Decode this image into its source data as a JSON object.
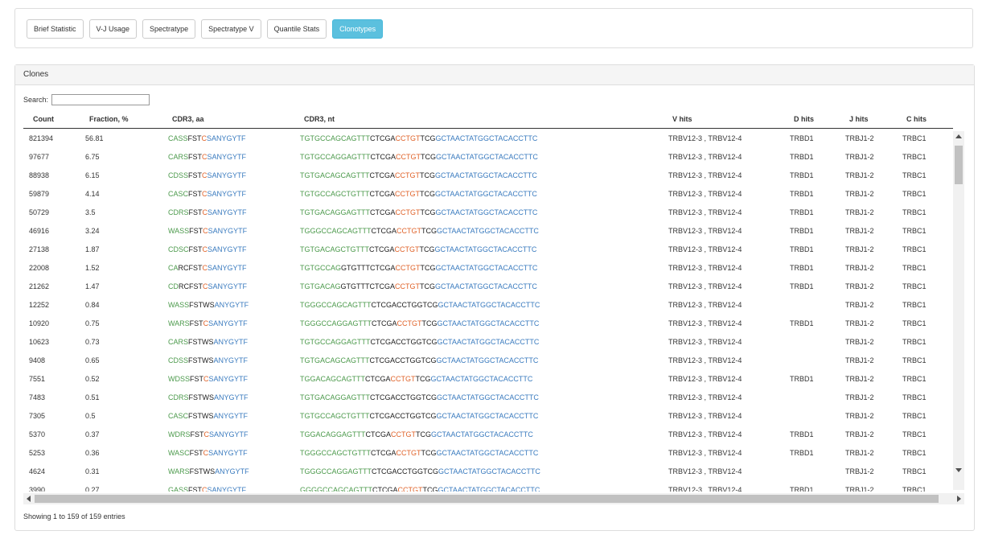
{
  "tabs": [
    {
      "label": "Brief Statistic",
      "active": false
    },
    {
      "label": "V-J Usage",
      "active": false
    },
    {
      "label": "Spectratype",
      "active": false
    },
    {
      "label": "Spectratype V",
      "active": false
    },
    {
      "label": "Quantile Stats",
      "active": false
    },
    {
      "label": "Clonotypes",
      "active": true
    }
  ],
  "panel": {
    "title": "Clones"
  },
  "search": {
    "label": "Search:",
    "value": ""
  },
  "columns": [
    "Count",
    "Fraction, %",
    "CDR3, aa",
    "CDR3, nt",
    "V hits",
    "D hits",
    "J hits",
    "C hits"
  ],
  "colors": {
    "green": "#4c9a4c",
    "black": "#222222",
    "orange": "#e0632a",
    "blue": "#3a7bbf",
    "active_tab": "#5bc0de"
  },
  "rows": [
    {
      "count": "821394",
      "fraction": "56.81",
      "aa": [
        [
          "CASS",
          "g"
        ],
        [
          "FST",
          "k"
        ],
        [
          "C",
          "o"
        ],
        [
          "SANYGYTF",
          "b"
        ]
      ],
      "nt": [
        [
          "TGTGCCAGCAGTTT",
          "g"
        ],
        [
          "CTCGA",
          "k"
        ],
        [
          "CCTGT",
          "o"
        ],
        [
          "TCG",
          "k"
        ],
        [
          "GCTAACTATGGCTACACCTTC",
          "b"
        ]
      ],
      "v": "TRBV12-3 , TRBV12-4",
      "d": "TRBD1",
      "j": "TRBJ1-2",
      "c": "TRBC1"
    },
    {
      "count": "97677",
      "fraction": "6.75",
      "aa": [
        [
          "CARS",
          "g"
        ],
        [
          "FST",
          "k"
        ],
        [
          "C",
          "o"
        ],
        [
          "SANYGYTF",
          "b"
        ]
      ],
      "nt": [
        [
          "TGTGCCAGGAGTTT",
          "g"
        ],
        [
          "CTCGA",
          "k"
        ],
        [
          "CCTGT",
          "o"
        ],
        [
          "TCG",
          "k"
        ],
        [
          "GCTAACTATGGCTACACCTTC",
          "b"
        ]
      ],
      "v": "TRBV12-3 , TRBV12-4",
      "d": "TRBD1",
      "j": "TRBJ1-2",
      "c": "TRBC1"
    },
    {
      "count": "88938",
      "fraction": "6.15",
      "aa": [
        [
          "CDSS",
          "g"
        ],
        [
          "FST",
          "k"
        ],
        [
          "C",
          "o"
        ],
        [
          "SANYGYTF",
          "b"
        ]
      ],
      "nt": [
        [
          "TGTGACAGCAGTTT",
          "g"
        ],
        [
          "CTCGA",
          "k"
        ],
        [
          "CCTGT",
          "o"
        ],
        [
          "TCG",
          "k"
        ],
        [
          "GCTAACTATGGCTACACCTTC",
          "b"
        ]
      ],
      "v": "TRBV12-3 , TRBV12-4",
      "d": "TRBD1",
      "j": "TRBJ1-2",
      "c": "TRBC1"
    },
    {
      "count": "59879",
      "fraction": "4.14",
      "aa": [
        [
          "CASC",
          "g"
        ],
        [
          "FST",
          "k"
        ],
        [
          "C",
          "o"
        ],
        [
          "SANYGYTF",
          "b"
        ]
      ],
      "nt": [
        [
          "TGTGCCAGCTGTTT",
          "g"
        ],
        [
          "CTCGA",
          "k"
        ],
        [
          "CCTGT",
          "o"
        ],
        [
          "TCG",
          "k"
        ],
        [
          "GCTAACTATGGCTACACCTTC",
          "b"
        ]
      ],
      "v": "TRBV12-3 , TRBV12-4",
      "d": "TRBD1",
      "j": "TRBJ1-2",
      "c": "TRBC1"
    },
    {
      "count": "50729",
      "fraction": "3.5",
      "aa": [
        [
          "CDRS",
          "g"
        ],
        [
          "FST",
          "k"
        ],
        [
          "C",
          "o"
        ],
        [
          "SANYGYTF",
          "b"
        ]
      ],
      "nt": [
        [
          "TGTGACAGGAGTTT",
          "g"
        ],
        [
          "CTCGA",
          "k"
        ],
        [
          "CCTGT",
          "o"
        ],
        [
          "TCG",
          "k"
        ],
        [
          "GCTAACTATGGCTACACCTTC",
          "b"
        ]
      ],
      "v": "TRBV12-3 , TRBV12-4",
      "d": "TRBD1",
      "j": "TRBJ1-2",
      "c": "TRBC1"
    },
    {
      "count": "46916",
      "fraction": "3.24",
      "aa": [
        [
          "WASS",
          "g"
        ],
        [
          "FST",
          "k"
        ],
        [
          "C",
          "o"
        ],
        [
          "SANYGYTF",
          "b"
        ]
      ],
      "nt": [
        [
          "TGGGCCAGCAGTTT",
          "g"
        ],
        [
          "CTCGA",
          "k"
        ],
        [
          "CCTGT",
          "o"
        ],
        [
          "TCG",
          "k"
        ],
        [
          "GCTAACTATGGCTACACCTTC",
          "b"
        ]
      ],
      "v": "TRBV12-3 , TRBV12-4",
      "d": "TRBD1",
      "j": "TRBJ1-2",
      "c": "TRBC1"
    },
    {
      "count": "27138",
      "fraction": "1.87",
      "aa": [
        [
          "CDSC",
          "g"
        ],
        [
          "FST",
          "k"
        ],
        [
          "C",
          "o"
        ],
        [
          "SANYGYTF",
          "b"
        ]
      ],
      "nt": [
        [
          "TGTGACAGCTGTTT",
          "g"
        ],
        [
          "CTCGA",
          "k"
        ],
        [
          "CCTGT",
          "o"
        ],
        [
          "TCG",
          "k"
        ],
        [
          "GCTAACTATGGCTACACCTTC",
          "b"
        ]
      ],
      "v": "TRBV12-3 , TRBV12-4",
      "d": "TRBD1",
      "j": "TRBJ1-2",
      "c": "TRBC1"
    },
    {
      "count": "22008",
      "fraction": "1.52",
      "aa": [
        [
          "CA",
          "g"
        ],
        [
          "RCFST",
          "k"
        ],
        [
          "C",
          "o"
        ],
        [
          "SANYGYTF",
          "b"
        ]
      ],
      "nt": [
        [
          "TGTGCCAG",
          "g"
        ],
        [
          "GTGTTTCTCGA",
          "k"
        ],
        [
          "CCTGT",
          "o"
        ],
        [
          "TCG",
          "k"
        ],
        [
          "GCTAACTATGGCTACACCTTC",
          "b"
        ]
      ],
      "v": "TRBV12-3 , TRBV12-4",
      "d": "TRBD1",
      "j": "TRBJ1-2",
      "c": "TRBC1"
    },
    {
      "count": "21262",
      "fraction": "1.47",
      "aa": [
        [
          "CD",
          "g"
        ],
        [
          "RCFST",
          "k"
        ],
        [
          "C",
          "o"
        ],
        [
          "SANYGYTF",
          "b"
        ]
      ],
      "nt": [
        [
          "TGTGACAG",
          "g"
        ],
        [
          "GTGTTTCTCGA",
          "k"
        ],
        [
          "CCTGT",
          "o"
        ],
        [
          "TCG",
          "k"
        ],
        [
          "GCTAACTATGGCTACACCTTC",
          "b"
        ]
      ],
      "v": "TRBV12-3 , TRBV12-4",
      "d": "TRBD1",
      "j": "TRBJ1-2",
      "c": "TRBC1"
    },
    {
      "count": "12252",
      "fraction": "0.84",
      "aa": [
        [
          "WASS",
          "g"
        ],
        [
          "FSTWS",
          "k"
        ],
        [
          "ANYGYTF",
          "b"
        ]
      ],
      "nt": [
        [
          "TGGGCCAGCAGTTT",
          "g"
        ],
        [
          "CTCGACCTGGTCG",
          "k"
        ],
        [
          "GCTAACTATGGCTACACCTTC",
          "b"
        ]
      ],
      "v": "TRBV12-3 , TRBV12-4",
      "d": "",
      "j": "TRBJ1-2",
      "c": "TRBC1"
    },
    {
      "count": "10920",
      "fraction": "0.75",
      "aa": [
        [
          "WARS",
          "g"
        ],
        [
          "FST",
          "k"
        ],
        [
          "C",
          "o"
        ],
        [
          "SANYGYTF",
          "b"
        ]
      ],
      "nt": [
        [
          "TGGGCCAGGAGTTT",
          "g"
        ],
        [
          "CTCGA",
          "k"
        ],
        [
          "CCTGT",
          "o"
        ],
        [
          "TCG",
          "k"
        ],
        [
          "GCTAACTATGGCTACACCTTC",
          "b"
        ]
      ],
      "v": "TRBV12-3 , TRBV12-4",
      "d": "TRBD1",
      "j": "TRBJ1-2",
      "c": "TRBC1"
    },
    {
      "count": "10623",
      "fraction": "0.73",
      "aa": [
        [
          "CARS",
          "g"
        ],
        [
          "FSTWS",
          "k"
        ],
        [
          "ANYGYTF",
          "b"
        ]
      ],
      "nt": [
        [
          "TGTGCCAGGAGTTT",
          "g"
        ],
        [
          "CTCGACCTGGTCG",
          "k"
        ],
        [
          "GCTAACTATGGCTACACCTTC",
          "b"
        ]
      ],
      "v": "TRBV12-3 , TRBV12-4",
      "d": "",
      "j": "TRBJ1-2",
      "c": "TRBC1"
    },
    {
      "count": "9408",
      "fraction": "0.65",
      "aa": [
        [
          "CDSS",
          "g"
        ],
        [
          "FSTWS",
          "k"
        ],
        [
          "ANYGYTF",
          "b"
        ]
      ],
      "nt": [
        [
          "TGTGACAGCAGTTT",
          "g"
        ],
        [
          "CTCGACCTGGTCG",
          "k"
        ],
        [
          "GCTAACTATGGCTACACCTTC",
          "b"
        ]
      ],
      "v": "TRBV12-3 , TRBV12-4",
      "d": "",
      "j": "TRBJ1-2",
      "c": "TRBC1"
    },
    {
      "count": "7551",
      "fraction": "0.52",
      "aa": [
        [
          "WDSS",
          "g"
        ],
        [
          "FST",
          "k"
        ],
        [
          "C",
          "o"
        ],
        [
          "SANYGYTF",
          "b"
        ]
      ],
      "nt": [
        [
          "TGGACAGCAGTTT",
          "g"
        ],
        [
          "CTCGA",
          "k"
        ],
        [
          "CCTGT",
          "o"
        ],
        [
          "TCG",
          "k"
        ],
        [
          "GCTAACTATGGCTACACCTTC",
          "b"
        ]
      ],
      "v": "TRBV12-3 , TRBV12-4",
      "d": "TRBD1",
      "j": "TRBJ1-2",
      "c": "TRBC1"
    },
    {
      "count": "7483",
      "fraction": "0.51",
      "aa": [
        [
          "CDRS",
          "g"
        ],
        [
          "FSTWS",
          "k"
        ],
        [
          "ANYGYTF",
          "b"
        ]
      ],
      "nt": [
        [
          "TGTGACAGGAGTTT",
          "g"
        ],
        [
          "CTCGACCTGGTCG",
          "k"
        ],
        [
          "GCTAACTATGGCTACACCTTC",
          "b"
        ]
      ],
      "v": "TRBV12-3 , TRBV12-4",
      "d": "",
      "j": "TRBJ1-2",
      "c": "TRBC1"
    },
    {
      "count": "7305",
      "fraction": "0.5",
      "aa": [
        [
          "CASC",
          "g"
        ],
        [
          "FSTWS",
          "k"
        ],
        [
          "ANYGYTF",
          "b"
        ]
      ],
      "nt": [
        [
          "TGTGCCAGCTGTTT",
          "g"
        ],
        [
          "CTCGACCTGGTCG",
          "k"
        ],
        [
          "GCTAACTATGGCTACACCTTC",
          "b"
        ]
      ],
      "v": "TRBV12-3 , TRBV12-4",
      "d": "",
      "j": "TRBJ1-2",
      "c": "TRBC1"
    },
    {
      "count": "5370",
      "fraction": "0.37",
      "aa": [
        [
          "WDRS",
          "g"
        ],
        [
          "FST",
          "k"
        ],
        [
          "C",
          "o"
        ],
        [
          "SANYGYTF",
          "b"
        ]
      ],
      "nt": [
        [
          "TGGACAGGAGTTT",
          "g"
        ],
        [
          "CTCGA",
          "k"
        ],
        [
          "CCTGT",
          "o"
        ],
        [
          "TCG",
          "k"
        ],
        [
          "GCTAACTATGGCTACACCTTC",
          "b"
        ]
      ],
      "v": "TRBV12-3 , TRBV12-4",
      "d": "TRBD1",
      "j": "TRBJ1-2",
      "c": "TRBC1"
    },
    {
      "count": "5253",
      "fraction": "0.36",
      "aa": [
        [
          "WASC",
          "g"
        ],
        [
          "FST",
          "k"
        ],
        [
          "C",
          "o"
        ],
        [
          "SANYGYTF",
          "b"
        ]
      ],
      "nt": [
        [
          "TGGGCCAGCTGTTT",
          "g"
        ],
        [
          "CTCGA",
          "k"
        ],
        [
          "CCTGT",
          "o"
        ],
        [
          "TCG",
          "k"
        ],
        [
          "GCTAACTATGGCTACACCTTC",
          "b"
        ]
      ],
      "v": "TRBV12-3 , TRBV12-4",
      "d": "TRBD1",
      "j": "TRBJ1-2",
      "c": "TRBC1"
    },
    {
      "count": "4624",
      "fraction": "0.31",
      "aa": [
        [
          "WARS",
          "g"
        ],
        [
          "FSTWS",
          "k"
        ],
        [
          "ANYGYTF",
          "b"
        ]
      ],
      "nt": [
        [
          "TGGGCCAGGAGTTT",
          "g"
        ],
        [
          "CTCGACCTGGTCG",
          "k"
        ],
        [
          "GCTAACTATGGCTACACCTTC",
          "b"
        ]
      ],
      "v": "TRBV12-3 , TRBV12-4",
      "d": "",
      "j": "TRBJ1-2",
      "c": "TRBC1"
    },
    {
      "count": "3990",
      "fraction": "0.27",
      "aa": [
        [
          "GASS",
          "g"
        ],
        [
          "FST",
          "k"
        ],
        [
          "C",
          "o"
        ],
        [
          "SANYGYTF",
          "b"
        ]
      ],
      "nt": [
        [
          "GGGGCCAGCAGTTT",
          "g"
        ],
        [
          "CTCGA",
          "k"
        ],
        [
          "CCTGT",
          "o"
        ],
        [
          "TCG",
          "k"
        ],
        [
          "GCTAACTATGGCTACACCTTC",
          "b"
        ]
      ],
      "v": "TRBV12-3 , TRBV12-4",
      "d": "TRBD1",
      "j": "TRBJ1-2",
      "c": "TRBC1"
    }
  ],
  "info": "Showing 1 to 159 of 159 entries"
}
